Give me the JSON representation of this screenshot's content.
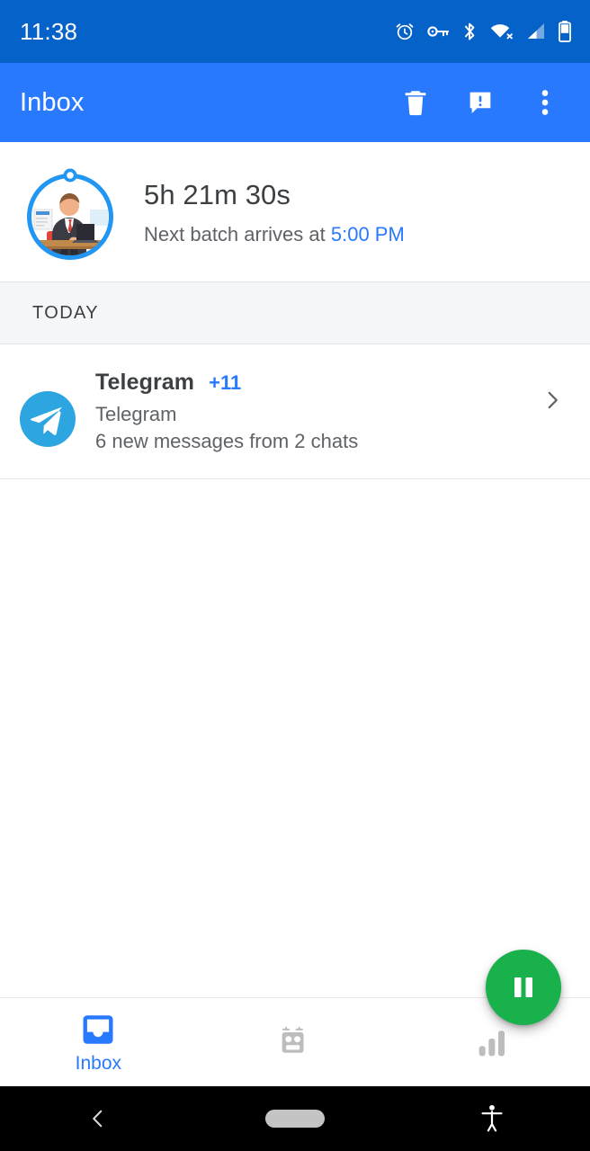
{
  "status_bar": {
    "time": "11:38",
    "icons": [
      "alarm-icon",
      "vpn-key-icon",
      "bluetooth-icon",
      "wifi-off-icon",
      "cellular-signal-icon",
      "battery-icon"
    ],
    "background_color": "#0562C9"
  },
  "toolbar": {
    "title": "Inbox",
    "background_color": "#2979FF",
    "actions": [
      {
        "name": "delete-button",
        "icon": "trash-icon"
      },
      {
        "name": "feedback-button",
        "icon": "feedback-icon"
      },
      {
        "name": "overflow-menu-button",
        "icon": "more-vert-icon"
      }
    ]
  },
  "timer_card": {
    "avatar": "person-at-laptop-avatar",
    "ring_color": "#2196F3",
    "countdown": "5h 21m 30s",
    "next_batch_prefix": "Next batch arrives at ",
    "next_batch_time": "5:00 PM",
    "accent_color": "#2979FF"
  },
  "section": {
    "header": "TODAY"
  },
  "notifications": [
    {
      "app_icon": "telegram-icon",
      "icon_color": "#2CA5E0",
      "title": "Telegram",
      "badge": "+11",
      "badge_color": "#2979FF",
      "subtitle_app": "Telegram",
      "subtitle_summary": "6 new messages from 2 chats",
      "chevron": "chevron-right-icon"
    }
  ],
  "fab": {
    "name": "pause-fab",
    "icon": "pause-icon",
    "color": "#19B14C"
  },
  "bottom_nav": {
    "tabs": [
      {
        "name": "tab-inbox",
        "label": "Inbox",
        "icon": "inbox-icon",
        "active": true,
        "color": "#2979FF"
      },
      {
        "name": "tab-bot",
        "label": "",
        "icon": "robot-icon",
        "active": false,
        "color": "#BDBDBD"
      },
      {
        "name": "tab-stats",
        "label": "",
        "icon": "bar-chart-icon",
        "active": false,
        "color": "#BDBDBD"
      }
    ]
  },
  "android_nav": {
    "back": "back-chevron-icon",
    "home": "home-pill-icon",
    "accessibility": "accessibility-icon"
  }
}
